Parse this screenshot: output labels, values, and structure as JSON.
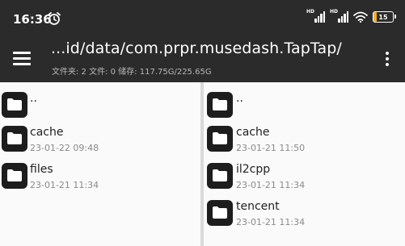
{
  "status": {
    "time": "16:36",
    "battery": "15",
    "signal1_label": "HD",
    "signal2_label": "HD",
    "battery_color": "#f2b02c"
  },
  "toolbar": {
    "path": "...id/data/com.prpr.musedash.TapTap/",
    "info": "文件夹: 2   文件: 0   储存: 117.75G/225.65G"
  },
  "left_pane": {
    "items": [
      {
        "name": "..",
        "date": "",
        "icon": "folder-icon"
      },
      {
        "name": "cache",
        "date": "23-01-22 09:48",
        "icon": "folder-icon"
      },
      {
        "name": "files",
        "date": "23-01-21 11:34",
        "icon": "folder-icon"
      }
    ]
  },
  "right_pane": {
    "items": [
      {
        "name": "..",
        "date": "",
        "icon": "folder-icon"
      },
      {
        "name": "cache",
        "date": "23-01-21 11:50",
        "icon": "folder-icon"
      },
      {
        "name": "il2cpp",
        "date": "23-01-21 11:34",
        "icon": "folder-icon"
      },
      {
        "name": "tencent",
        "date": "23-01-21 11:34",
        "icon": "folder-icon"
      }
    ]
  }
}
